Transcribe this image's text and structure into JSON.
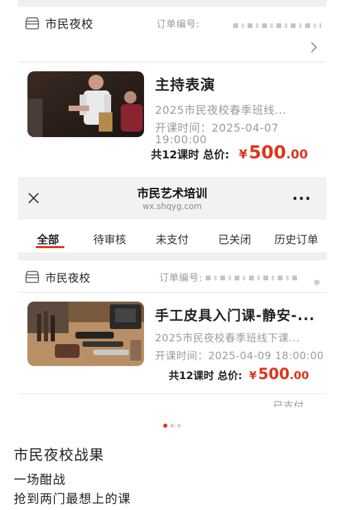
{
  "order1": {
    "shop_name": "市民夜校",
    "order_label": "订单编号:",
    "course_title": "主持表演",
    "course_subtitle": "2025市民夜校春季班线...",
    "start_time_label": "开课时间：2025-04-07",
    "start_time_cont": "19:00:00",
    "total_label": "共12课时 总价:",
    "currency": "¥",
    "price_int": "500",
    "price_dec": ".00",
    "shop_icon": "shop-icon",
    "chevron_icon": "chevron-right-icon"
  },
  "miniprogram": {
    "title": "市民艺术培训",
    "url": "wx.shqyg.com",
    "close_icon": "close-icon",
    "more_label": "···"
  },
  "tabs": [
    {
      "label": "全部",
      "active": true
    },
    {
      "label": "待审核",
      "active": false
    },
    {
      "label": "未支付",
      "active": false
    },
    {
      "label": "已关闭",
      "active": false
    },
    {
      "label": "历史订单",
      "active": false
    }
  ],
  "order2": {
    "shop_name": "市民夜校",
    "order_label": "订单编号:",
    "course_title": "手工皮具入门课-静安-...",
    "course_subtitle": "2025市民夜校春季班线下课...",
    "start_time_label": "开课时间：2025-04-09 18:00:00",
    "total_label": "共12课时 总价:",
    "currency": "¥",
    "price_int": "500",
    "price_dec": ".00",
    "partial_status": "已支付"
  },
  "carousel": {
    "count": 3,
    "active": 0
  },
  "caption": {
    "title": "市民夜校战果",
    "line1": "一场酣战",
    "line2": "抢到两门最想上的课"
  },
  "colors": {
    "accent": "#e0341c",
    "muted": "#9b9b9b",
    "band": "#f0f0f0"
  }
}
